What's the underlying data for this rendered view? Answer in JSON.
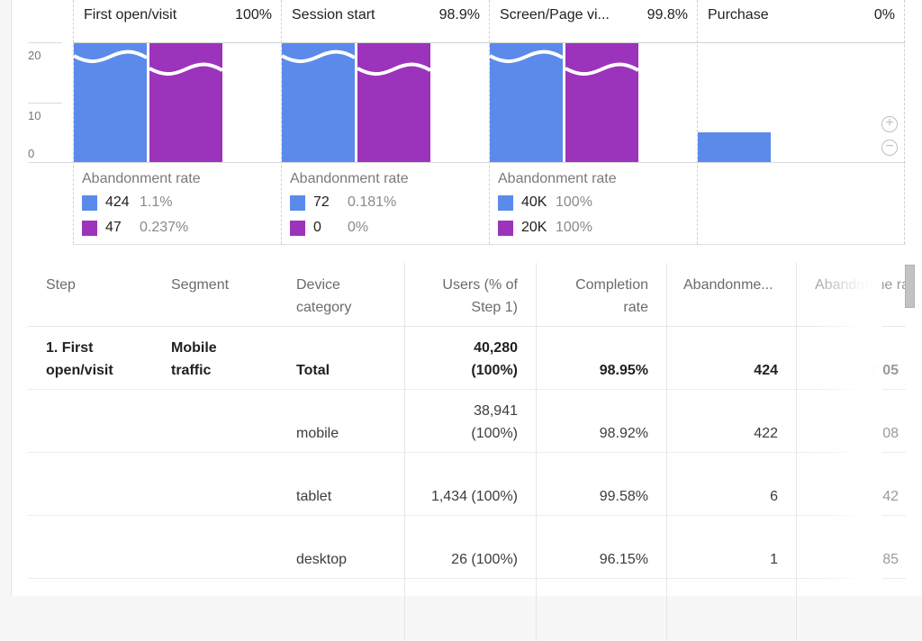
{
  "chart_data": {
    "type": "bar",
    "title": "",
    "y_ticks": [
      "20",
      "10",
      "0"
    ],
    "ylim": [
      0,
      20
    ],
    "series_colors": {
      "segment_1": "#5b8aeb",
      "segment_2": "#9c33bb"
    },
    "steps": [
      {
        "name": "First open/visit",
        "completion_pct": "100%",
        "bars": [
          {
            "series": "segment_1",
            "relative_height": 1.0,
            "truncated": true
          },
          {
            "series": "segment_2",
            "relative_height": 1.0,
            "truncated": true
          }
        ],
        "abandonment": {
          "title": "Abandonment rate",
          "rows": [
            {
              "series": "segment_1",
              "count": "424",
              "rate": "1.1%"
            },
            {
              "series": "segment_2",
              "count": "47",
              "rate": "0.237%"
            }
          ]
        }
      },
      {
        "name": "Session start",
        "completion_pct": "98.9%",
        "bars": [
          {
            "series": "segment_1",
            "relative_height": 1.0,
            "truncated": true
          },
          {
            "series": "segment_2",
            "relative_height": 1.0,
            "truncated": true
          }
        ],
        "abandonment": {
          "title": "Abandonment rate",
          "rows": [
            {
              "series": "segment_1",
              "count": "72",
              "rate": "0.181%"
            },
            {
              "series": "segment_2",
              "count": "0",
              "rate": "0%"
            }
          ]
        }
      },
      {
        "name": "Screen/Page vi...",
        "completion_pct": "99.8%",
        "bars": [
          {
            "series": "segment_1",
            "relative_height": 1.0,
            "truncated": true
          },
          {
            "series": "segment_2",
            "relative_height": 1.0,
            "truncated": true
          }
        ],
        "abandonment": {
          "title": "Abandonment rate",
          "rows": [
            {
              "series": "segment_1",
              "count": "40K",
              "rate": "100%"
            },
            {
              "series": "segment_2",
              "count": "20K",
              "rate": "100%"
            }
          ]
        }
      },
      {
        "name": "Purchase",
        "completion_pct": "0%",
        "bars": [
          {
            "series": "segment_1",
            "value": 5,
            "truncated": false
          }
        ],
        "abandonment": null
      }
    ]
  },
  "controls": {
    "zoom_in": "+",
    "zoom_out": "−"
  },
  "table": {
    "headers": {
      "step": "Step",
      "segment": "Segment",
      "device": "Device category",
      "users": "Users (% of Step 1)",
      "completion": "Completion rate",
      "abandonments": "Abandonme...",
      "abandonment_rate": "Abandonme ra"
    },
    "rows": [
      {
        "step": "1. First open/visit",
        "segment": "Mobile traffic",
        "device": "Total",
        "users_count": "40,280",
        "users_pct": "(100%)",
        "completion": "98.95%",
        "abandonments": "424",
        "abandonment_rate": "1.05",
        "bold": true
      },
      {
        "step": "",
        "segment": "",
        "device": "mobile",
        "users_count": "38,941",
        "users_pct": "(100%)",
        "completion": "98.92%",
        "abandonments": "422",
        "abandonment_rate": "1.08",
        "bold": false
      },
      {
        "step": "",
        "segment": "",
        "device": "tablet",
        "users_count": "1,434 (100%)",
        "users_pct": "",
        "completion": "99.58%",
        "abandonments": "6",
        "abandonment_rate": "0.42",
        "bold": false
      },
      {
        "step": "",
        "segment": "",
        "device": "desktop",
        "users_count": "26 (100%)",
        "users_pct": "",
        "completion": "96.15%",
        "abandonments": "1",
        "abandonment_rate": "3.85",
        "bold": false
      }
    ]
  }
}
